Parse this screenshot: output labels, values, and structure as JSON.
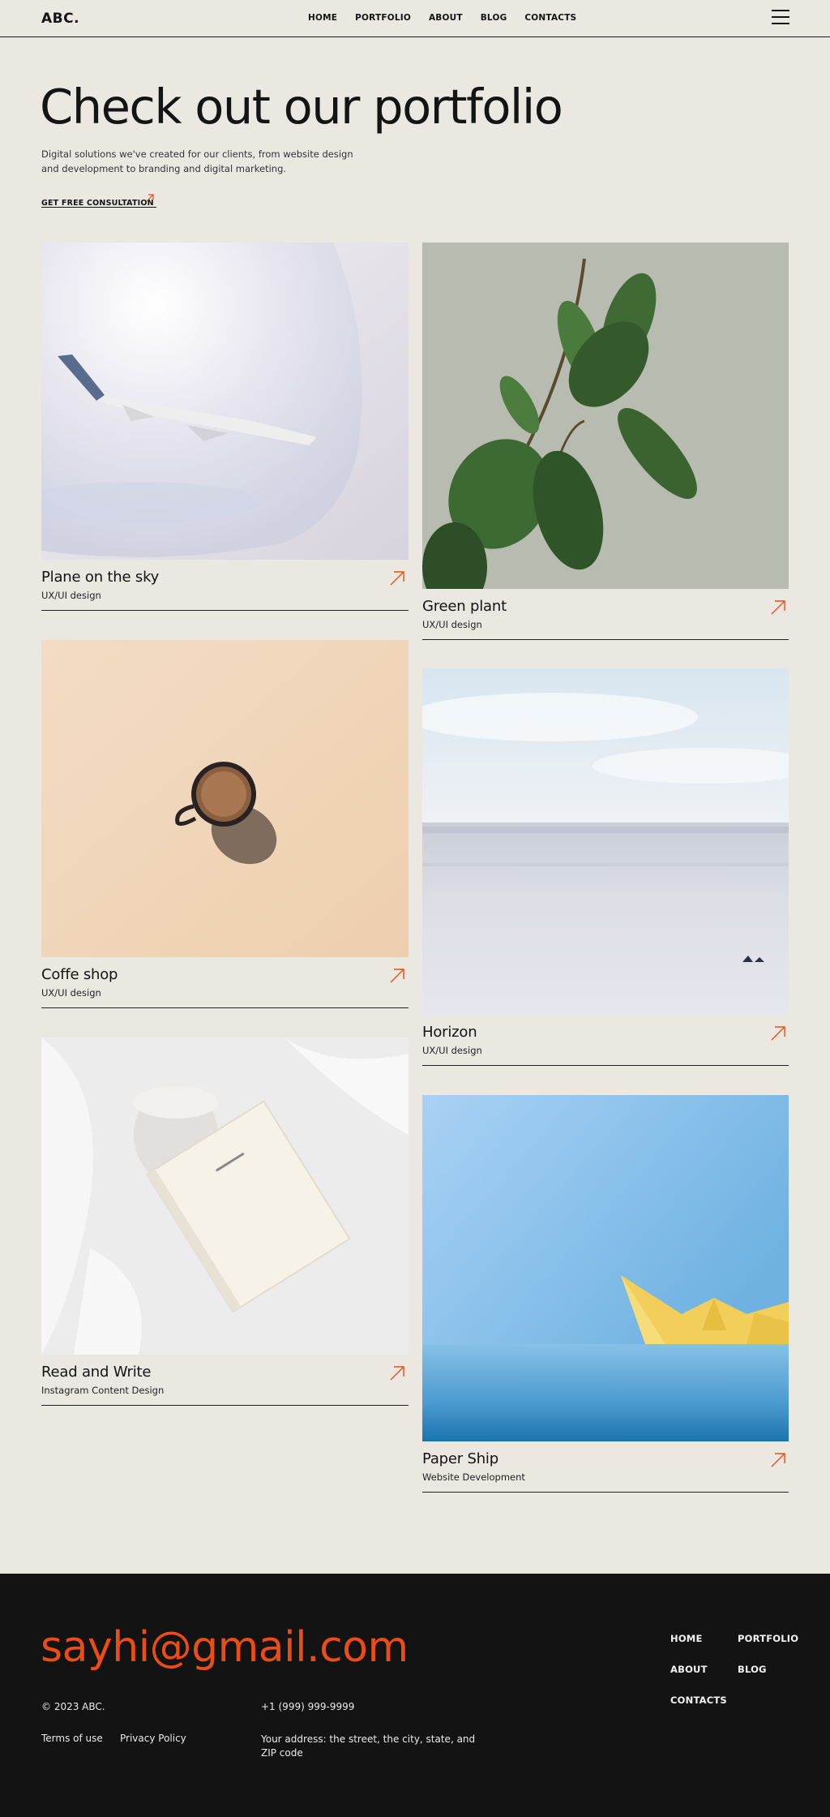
{
  "header": {
    "logo": "ABC.",
    "nav": [
      "HOME",
      "PORTFOLIO",
      "ABOUT",
      "BLOG",
      "CONTACTS"
    ]
  },
  "hero": {
    "title": "Check out our portfolio",
    "description": "Digital solutions we've created for our clients, from website design and development to branding and digital marketing.",
    "cta": "GET FREE CONSULTATION"
  },
  "projects": [
    {
      "title": "Plane on the sky",
      "category": "UX/UI design"
    },
    {
      "title": "Green plant",
      "category": "UX/UI design"
    },
    {
      "title": "Coffe shop",
      "category": "UX/UI design"
    },
    {
      "title": "Horizon",
      "category": "UX/UI design"
    },
    {
      "title": "Read and Write",
      "category": "Instagram Content Design"
    },
    {
      "title": "Paper Ship",
      "category": "Website Development"
    }
  ],
  "footer": {
    "email": "sayhi@gmail.com",
    "copyright": "© 2023 ABC.",
    "terms": "Terms of use",
    "privacy": "Privacy Policy",
    "phone": "+1 (999) 999-9999",
    "address": "Your address: the street, the city, state, and ZIP code",
    "nav": [
      "HOME",
      "PORTFOLIO",
      "ABOUT",
      "BLOG",
      "CONTACTS"
    ]
  },
  "colors": {
    "accent": "#ec4c15",
    "background": "#ebe8e2",
    "footer_bg": "#131313"
  }
}
